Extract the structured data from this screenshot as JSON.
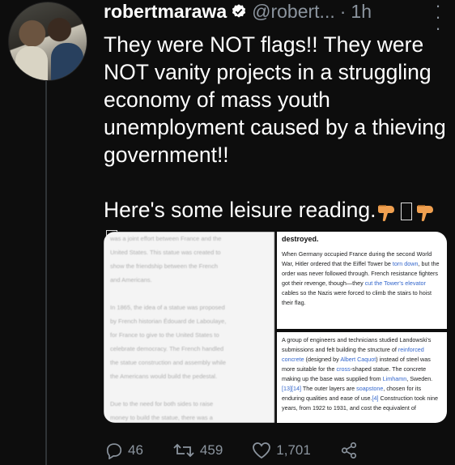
{
  "author": {
    "name": "robertmarawa",
    "handle": "@robert...",
    "separator": "·",
    "time": "1h"
  },
  "tweet": {
    "text": "They were NOT flags!! They were NOT vanity projects in a struggling economy of mass youth unemployment caused by a thieving government!!\n\nHere's some leisure reading."
  },
  "media": {
    "left_lines": [
      "was a joint effort between France and the",
      "United States. This statue was created to",
      "show the friendship between the French",
      "and Americans.",
      "",
      "In 1865, the idea of a statue was proposed",
      "by French historian Édouard de Laboulaye,",
      "for France to give to the United States to",
      "celebrate democracy. The French handled",
      "the statue construction and assembly while",
      "the Americans would build the pedestal.",
      "",
      "Due to the need for both sides to raise",
      "money to build the statue, there was a",
      "muddle in between the three extremal and"
    ],
    "top_heading": "destroyed.",
    "top_parts": [
      {
        "t": "When Germany occupied France during the second World War, Hitler ordered that the Eiffel Tower be "
      },
      {
        "t": "torn down",
        "link": true
      },
      {
        "t": ", but the order was never followed through. French resistance fighters got their revenge, though—they "
      },
      {
        "t": "cut the Tower's elevator",
        "link": true
      },
      {
        "t": " cables so the Nazis were forced to climb the stairs to hoist their flag."
      }
    ],
    "bottom_parts": [
      {
        "t": "A group of engineers and technicians studied Landowski's submissions and felt building the structure of "
      },
      {
        "t": "reinforced concrete",
        "link": true
      },
      {
        "t": " (designed by "
      },
      {
        "t": "Albert Caquot",
        "link": true
      },
      {
        "t": ") instead of steel was more suitable for the "
      },
      {
        "t": "cross",
        "link": true
      },
      {
        "t": "-shaped statue. The concrete making up the base was supplied from "
      },
      {
        "t": "Limhamn",
        "link": true
      },
      {
        "t": ", Sweden."
      },
      {
        "t": "[13][14]",
        "link": true
      },
      {
        "t": " The outer layers are "
      },
      {
        "t": "soapstone",
        "link": true
      },
      {
        "t": ", chosen for its enduring qualities and ease of use."
      },
      {
        "t": "[4]",
        "link": true
      },
      {
        "t": " Construction took nine years, from 1922 to 1931, and cost the equivalent of"
      }
    ]
  },
  "actions": {
    "replies": "46",
    "retweets": "459",
    "likes": "1,701"
  },
  "colors": {
    "background": "#0d0d0d",
    "secondary_text": "#8b949e",
    "verified": "#ffffff",
    "link": "#3366cc"
  }
}
